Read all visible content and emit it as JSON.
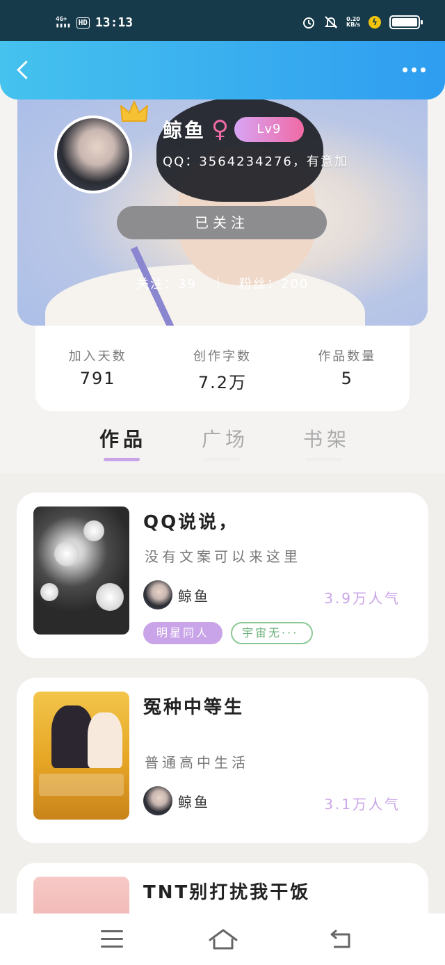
{
  "status_bar": {
    "network": "4G+",
    "hd": "HD",
    "time": "13:13",
    "speed_value": "0.20",
    "speed_unit": "KB/s"
  },
  "profile": {
    "username": "鲸鱼",
    "gender_symbol": "♀",
    "level": "Lv9",
    "bio": "QQ：3564234276，有意加",
    "follow_button": "已关注",
    "following": "关注：39",
    "fans": "粉丝：200"
  },
  "stats": [
    {
      "label": "加入天数",
      "value": "791"
    },
    {
      "label": "创作字数",
      "value": "7.2万"
    },
    {
      "label": "作品数量",
      "value": "5"
    }
  ],
  "tabs": [
    {
      "label": "作品"
    },
    {
      "label": "广场"
    },
    {
      "label": "书架"
    }
  ],
  "works": [
    {
      "title": "QQ说说，",
      "desc": "没有文案可以来这里",
      "author": "鲸鱼",
      "popularity": "3.9万人气",
      "tags": [
        "明星同人",
        "宇宙无···"
      ]
    },
    {
      "title": "冤种中等生",
      "desc": "普通高中生活",
      "author": "鲸鱼",
      "popularity": "3.1万人气"
    },
    {
      "title": "TNT别打扰我干饭"
    }
  ],
  "colors": {
    "accent": "#c9a4e8",
    "top_bar": "#2f9df0",
    "gender": "#f06aa6",
    "tag_outline": "#8cc896"
  },
  "icons": [
    "back-arrow-icon",
    "more-icon",
    "alarm-icon",
    "mute-icon",
    "charging-icon",
    "battery-icon",
    "crown-icon",
    "menu-icon",
    "home-icon",
    "return-icon"
  ]
}
